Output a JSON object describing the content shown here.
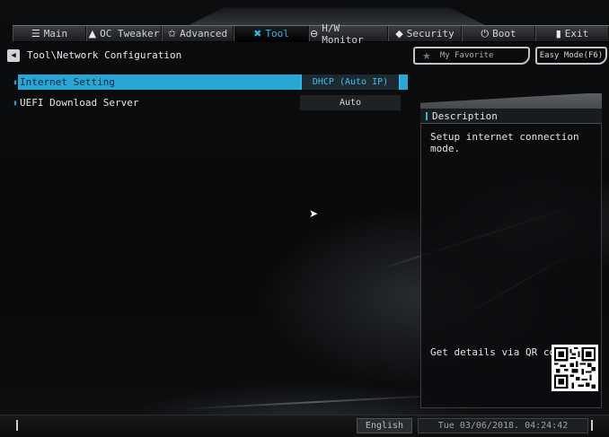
{
  "nav": {
    "tabs": [
      {
        "label": "Main",
        "icon": "list-icon",
        "glyph": "☰",
        "active": false
      },
      {
        "label": "OC Tweaker",
        "icon": "rocket-icon",
        "glyph": "▲",
        "active": false
      },
      {
        "label": "Advanced",
        "icon": "star-icon",
        "glyph": "✩",
        "active": false
      },
      {
        "label": "Tool",
        "icon": "tool-icon",
        "glyph": "✖",
        "active": true
      },
      {
        "label": "H/W Monitor",
        "icon": "monitor-icon",
        "glyph": "⊖",
        "active": false
      },
      {
        "label": "Security",
        "icon": "shield-icon",
        "glyph": "◆",
        "active": false
      },
      {
        "label": "Boot",
        "icon": "power-icon",
        "glyph": "⏻",
        "active": false
      },
      {
        "label": "Exit",
        "icon": "exit-icon",
        "glyph": "▮",
        "active": false
      }
    ]
  },
  "header": {
    "path": "Tool\\Network Configuration",
    "back_glyph": "◀",
    "my_favorite": "My Favorite",
    "favorite_glyph": "★",
    "easy_mode": "Easy Mode(F6)"
  },
  "settings": [
    {
      "label": "Internet Setting",
      "value": "DHCP (Auto IP)",
      "selected": true
    },
    {
      "label": "UEFI Download Server",
      "value": "Auto",
      "selected": false
    }
  ],
  "description": {
    "title": "Description",
    "text": "Setup internet connection mode.",
    "qr_label": "Get details via QR code"
  },
  "footer": {
    "language": "English",
    "datetime": "Tue 03/06/2018. 04:24:42"
  },
  "colors": {
    "accent": "#2fb8e6",
    "background": "#08090b"
  }
}
